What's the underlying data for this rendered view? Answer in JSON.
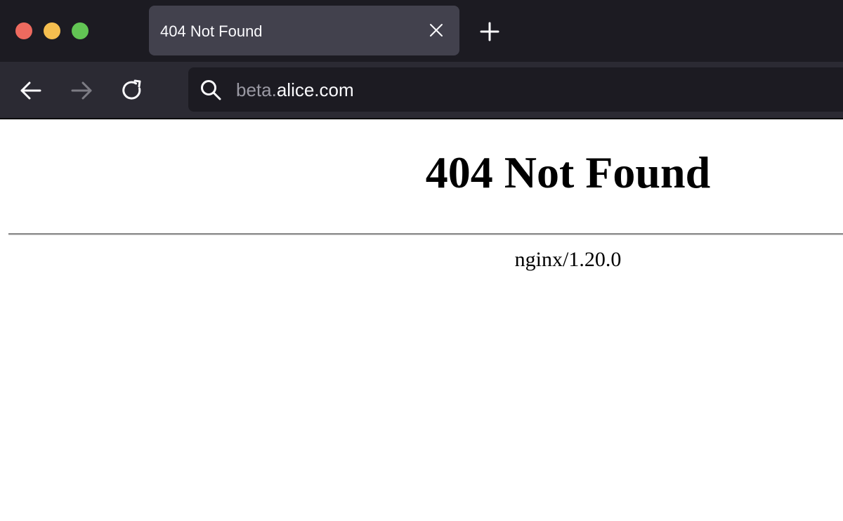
{
  "browser": {
    "tab": {
      "title": "404 Not Found"
    },
    "address_bar": {
      "subdomain": "beta.",
      "domain": "alice.com"
    },
    "icons": {
      "traffic_lights": [
        "close",
        "minimize",
        "maximize"
      ],
      "tab_close": "close-icon",
      "new_tab": "plus-icon",
      "back": "arrow-left-icon",
      "forward": "arrow-right-icon",
      "reload": "reload-icon",
      "search": "search-icon"
    },
    "colors": {
      "tabbar_bg": "#1c1b22",
      "navbar_bg": "#2b2a33",
      "active_tab_bg": "#42414d",
      "traffic_close": "#ee6a5f",
      "traffic_min": "#f5be4f",
      "traffic_max": "#62c554"
    }
  },
  "page": {
    "heading": "404 Not Found",
    "server": "nginx/1.20.0"
  }
}
